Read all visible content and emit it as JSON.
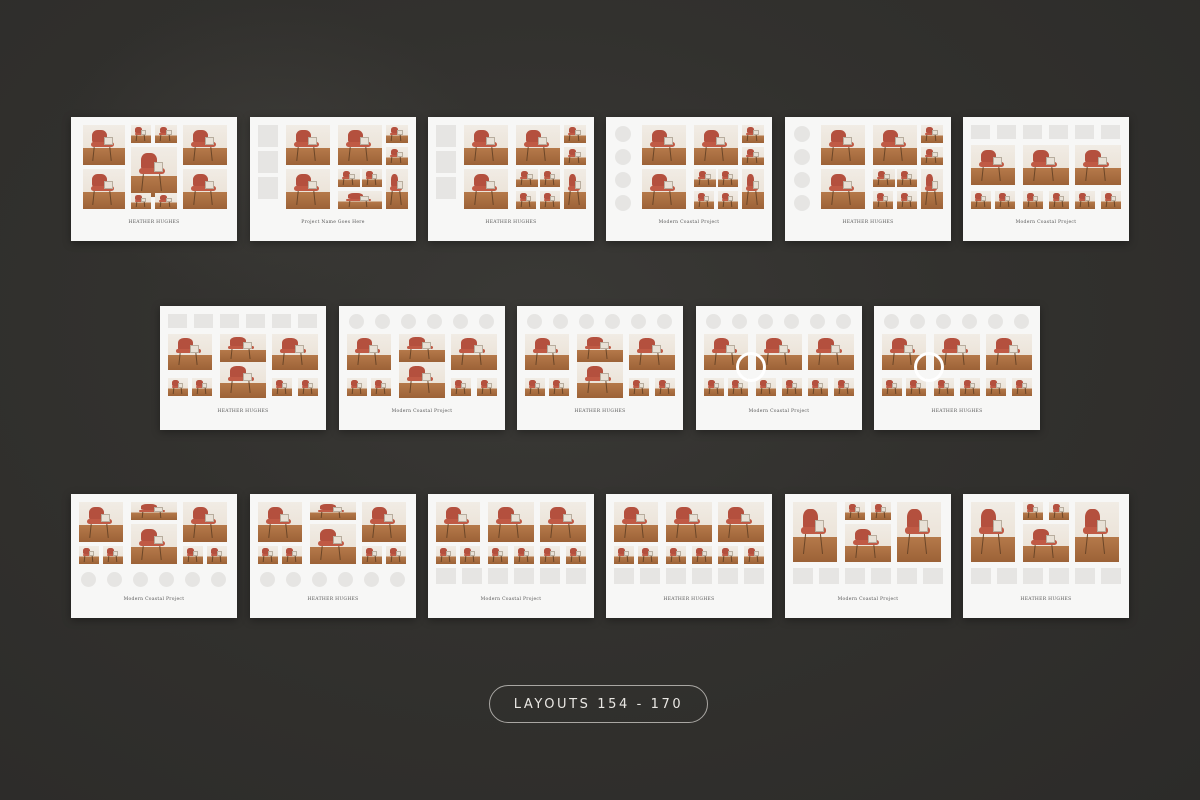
{
  "caption": "LAYOUTS 154 - 170",
  "titles": {
    "studio": "HEATHER HUGHES",
    "project": "Modern Coastal Project",
    "name_here": "Project Name Goes Here"
  },
  "colors": {
    "background": "#302f2d",
    "page": "#f7f7f6",
    "placeholder": "#e6e5e3"
  },
  "icons": [
    "chair-photo",
    "square-placeholder",
    "circle-placeholder"
  ]
}
